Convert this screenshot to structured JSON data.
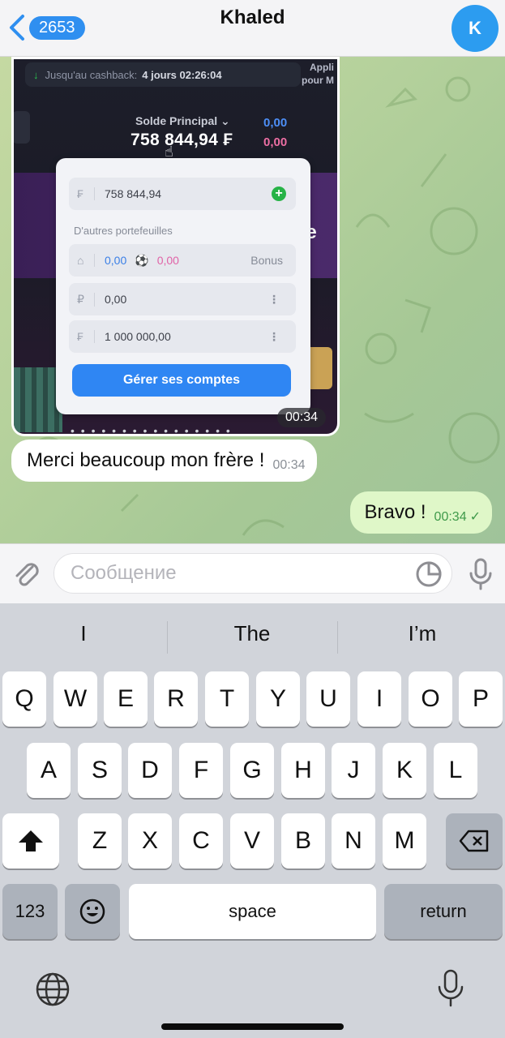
{
  "header": {
    "back_count": "2653",
    "title": "Khaled",
    "avatar_initial": "K"
  },
  "photo": {
    "cashback_label": "Jusqu'au cashback:",
    "cashback_timer": "4 jours 02:26:04",
    "applis_line1": "Appli",
    "applis_line2": "pour M",
    "solde_label": "Solde Principal ⌄",
    "solde_value": "758 844,94 ₣",
    "mini_value_1": "0,00",
    "mini_value_2": "0,00",
    "main_wallet_currency": "₣",
    "main_wallet_value": "758 844,94",
    "other_wallets_label": "D'autres portefeuilles",
    "bonus_value_1": "0,00",
    "bonus_value_2": "0,00",
    "bonus_label": "Bonus",
    "wallet_p_currency": "₽",
    "wallet_p_value": "0,00",
    "wallet_f_currency": "₣",
    "wallet_f_value": "1 000 000,00",
    "manage_button": "Gérer ses comptes",
    "side_text": "ete ici",
    "time": "00:34"
  },
  "messages": [
    {
      "direction": "in",
      "text": "Merci beaucoup mon frère !",
      "time": "00:34"
    },
    {
      "direction": "out",
      "text": "Bravo !",
      "time": "00:34",
      "status": "✓"
    }
  ],
  "composer": {
    "placeholder": "Сообщение"
  },
  "keyboard": {
    "suggestions": [
      "I",
      "The",
      "I’m"
    ],
    "row1": [
      "Q",
      "W",
      "E",
      "R",
      "T",
      "Y",
      "U",
      "I",
      "O",
      "P"
    ],
    "row2": [
      "A",
      "S",
      "D",
      "F",
      "G",
      "H",
      "J",
      "K",
      "L"
    ],
    "row3": [
      "Z",
      "X",
      "C",
      "V",
      "B",
      "N",
      "M"
    ],
    "numbers_label": "123",
    "space_label": "space",
    "return_label": "return"
  },
  "colors": {
    "accent": "#2f8ff0",
    "outgoing_bubble": "#dff7c8",
    "chat_bg": "#b5d19c"
  }
}
